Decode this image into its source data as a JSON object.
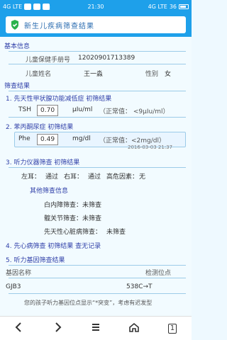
{
  "status": {
    "left_text": "4G LTE",
    "time": "21:30",
    "right_text": "4G LTE",
    "battery": "36"
  },
  "browser": {
    "title": "新生儿疾病筛查结果"
  },
  "report": {
    "basic_info": {
      "title": "基本信息",
      "screening_id_label": "儿童保健手册号",
      "screening_id": "12020901713389",
      "child_name_label": "儿童姓名",
      "child_name": "王一淼",
      "gender_label": "性别",
      "gender": "女"
    },
    "screen_results": {
      "title": "筛查结果",
      "item1": {
        "title": "1. 先天性甲状腺功能减低症 初筛结果",
        "test": "TSH",
        "value": "0.70",
        "unit": "μIu/ml",
        "normal": "（正常值： <9μIu/ml）"
      },
      "item2": {
        "title": "2. 苯丙酮尿症 初筛结果",
        "test": "Phe",
        "value": "0.49",
        "unit": "mg/dl",
        "normal": "（正常值：<2mg/dl）",
        "timestamp": "2016-03-03 21:37"
      },
      "item3": {
        "title": "3. 听力仪器筛查 初筛结果",
        "left_label": "左耳：",
        "left_value": "通过",
        "right_label": "右耳：",
        "right_value": "通过",
        "risk_label": "高危因素：",
        "risk_value": "无"
      },
      "other": {
        "title": "其他筛查信息",
        "items": [
          {
            "label": "白内障筛查：",
            "value": "未筛查"
          },
          {
            "label": "髋关节筛查：",
            "value": "未筛查"
          },
          {
            "label": "先天性心脏病筛查：",
            "value": "未筛查"
          }
        ]
      },
      "item4": {
        "title": "4. 先心病筛查 初筛结果 查无记录"
      },
      "item5": {
        "title": "5. 听力基因筛查结果",
        "gene_label": "基因名称",
        "site_label": "检测位点",
        "gene": "GJB3",
        "site": "538C→T",
        "note": "您的孩子听力基因位点显示“*突变”，考虑有迟发型"
      }
    }
  },
  "nav": {
    "tabs": "1"
  }
}
